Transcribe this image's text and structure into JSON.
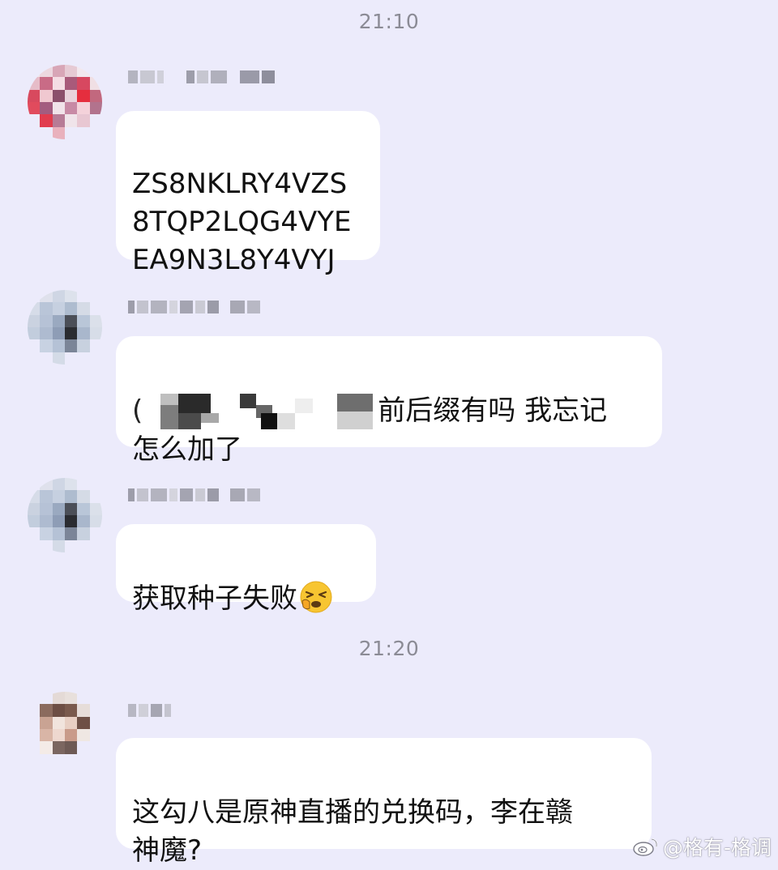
{
  "chat": {
    "timestamps": [
      "21:10",
      "21:20"
    ],
    "messages": [
      {
        "text": "ZS8NKLRY4VZS\n8TQP2LQG4VYE\nEA9N3L8Y4VYJ"
      },
      {
        "prefix": "(",
        "text": "前后缀有吗 我忘记\n怎么加了"
      },
      {
        "text": "获取种子失败",
        "emoji": "tired-face-emoji"
      },
      {
        "text": "这勾八是原神直播的兑换码，李在赣\n神魔?"
      }
    ]
  },
  "watermark": {
    "text": "@格有-格调",
    "icon": "weibo-icon"
  },
  "colors": {
    "background": "#ecebfb",
    "bubble": "#ffffff",
    "timestamp": "#8b8b95",
    "text": "#111111"
  }
}
